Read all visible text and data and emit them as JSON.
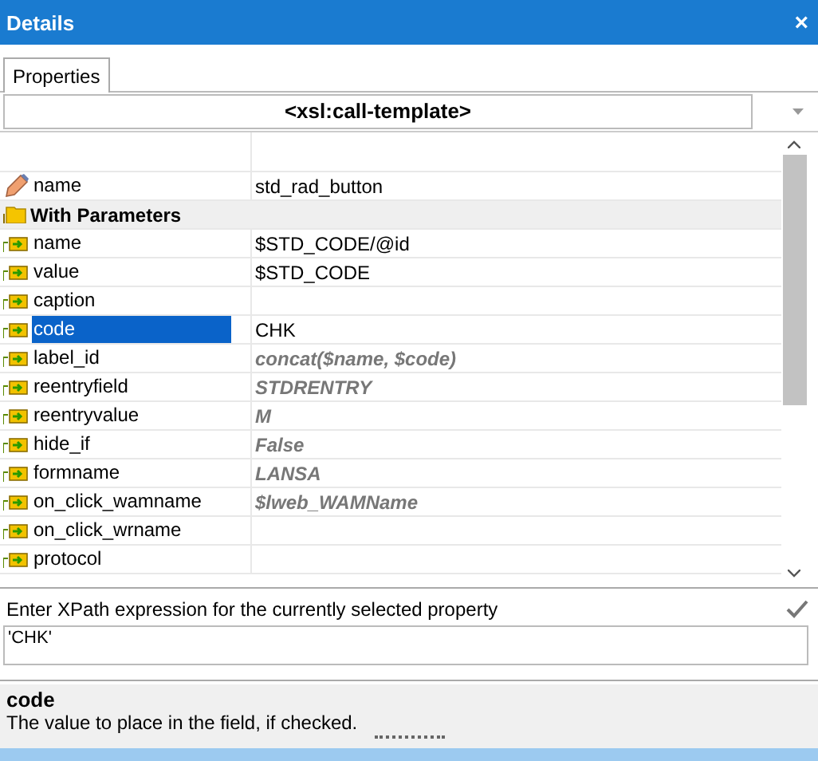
{
  "window": {
    "title": "Details",
    "close": "×"
  },
  "tabs": [
    {
      "label": "Properties",
      "selected": true
    }
  ],
  "element_selector": {
    "value": "<xsl:call-template>"
  },
  "rows": [
    {
      "kind": "property",
      "name": "name",
      "value": "std_rad_button",
      "expression": false,
      "selected": false
    },
    {
      "kind": "group",
      "name": "With Parameters"
    },
    {
      "kind": "param",
      "name": "name",
      "value": "$STD_CODE/@id",
      "expression": false,
      "selected": false
    },
    {
      "kind": "param",
      "name": "value",
      "value": "$STD_CODE",
      "expression": false,
      "selected": false
    },
    {
      "kind": "param",
      "name": "caption",
      "selected": false
    },
    {
      "kind": "param",
      "name": "code",
      "value": "CHK",
      "expression": false,
      "selected": true
    },
    {
      "kind": "param",
      "name": "label_id",
      "value": "concat($name, $code)",
      "expression": true,
      "selected": false
    },
    {
      "kind": "param",
      "name": "reentryfield",
      "value": "STDRENTRY",
      "expression": true,
      "selected": false
    },
    {
      "kind": "param",
      "name": "reentryvalue",
      "value": "M",
      "expression": true,
      "selected": false
    },
    {
      "kind": "param",
      "name": "hide_if",
      "value": "False",
      "expression": true,
      "selected": false
    },
    {
      "kind": "param",
      "name": "formname",
      "value": "LANSA",
      "expression": true,
      "selected": false
    },
    {
      "kind": "param",
      "name": "on_click_wamname",
      "value": "$lweb_WAMName",
      "expression": true,
      "selected": false
    },
    {
      "kind": "param",
      "name": "on_click_wrname",
      "selected": false
    },
    {
      "kind": "param",
      "name": "protocol",
      "selected": false
    }
  ],
  "xpath": {
    "label": "Enter XPath expression for the currently selected property",
    "value": "'CHK'"
  },
  "description": {
    "title": "code",
    "text": "The value to place in the field, if checked."
  }
}
